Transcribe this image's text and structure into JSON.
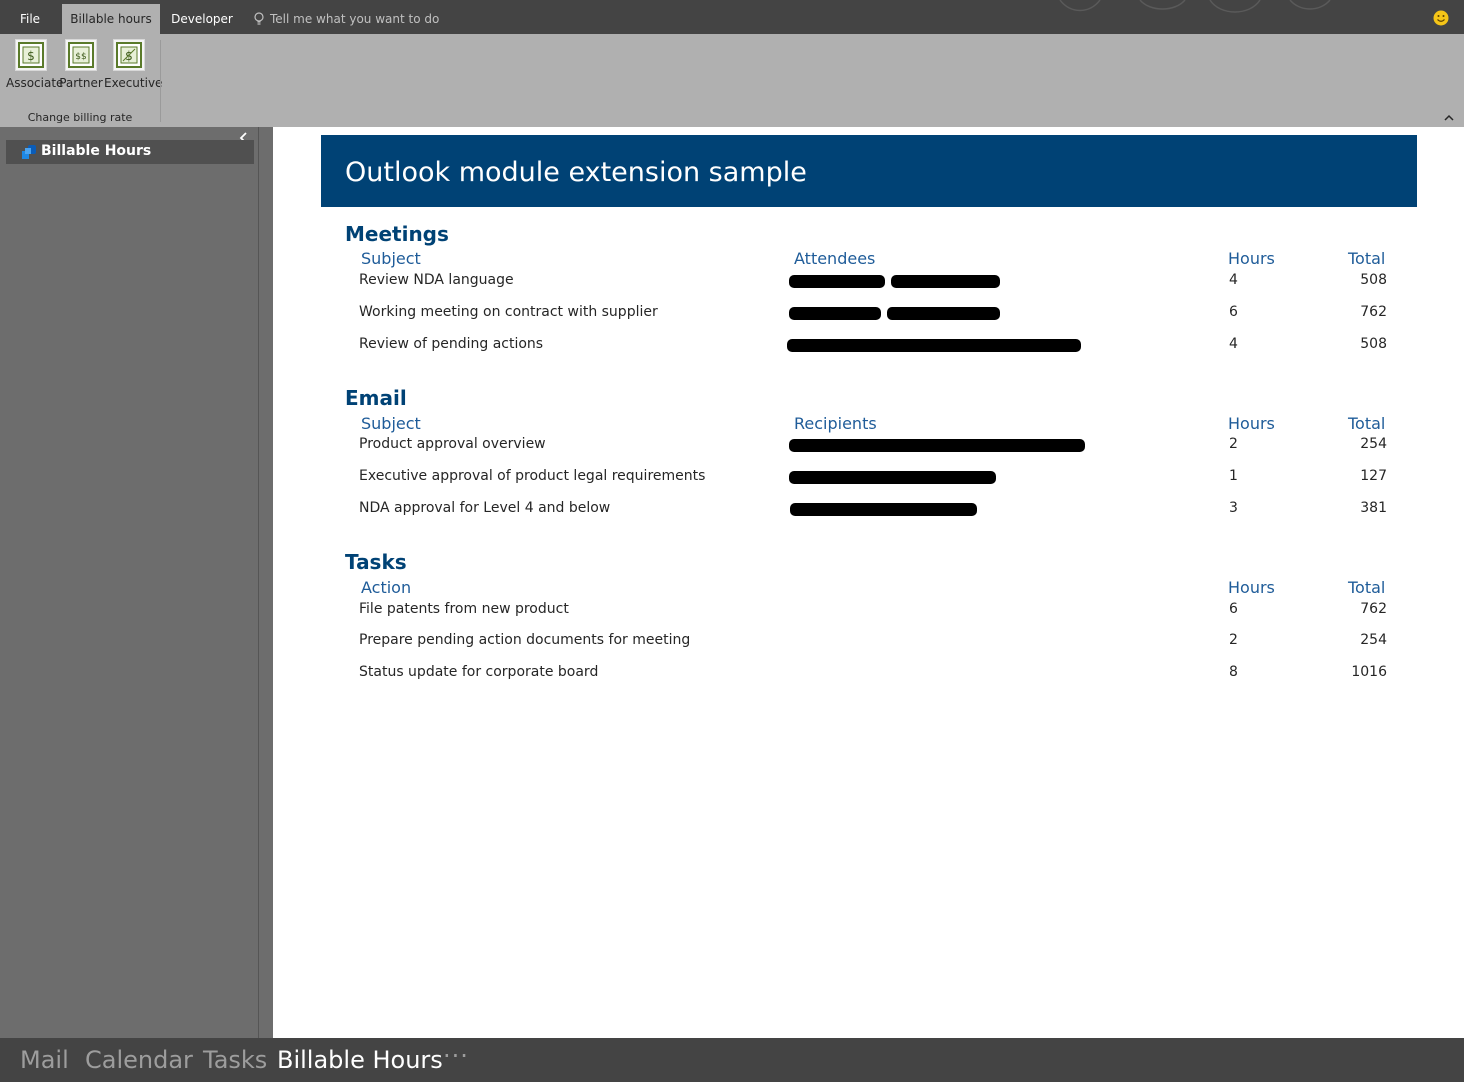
{
  "tabs": {
    "file": "File",
    "billable_hours": "Billable hours",
    "developer": "Developer",
    "tell_me_placeholder": "Tell me what you want to do"
  },
  "ribbon": {
    "buttons": [
      {
        "label": "Associate",
        "icon": "dollar-icon"
      },
      {
        "label": "Partner",
        "icon": "dollar-icon"
      },
      {
        "label": "Executive",
        "icon": "dollar-icon"
      }
    ],
    "group_label": "Change billing rate"
  },
  "navigation": {
    "item": "Billable Hours"
  },
  "main": {
    "title": "Outlook module extension sample",
    "meetings": {
      "title": "Meetings",
      "headers": {
        "subject": "Subject",
        "attendees": "Attendees",
        "hours": "Hours",
        "total": "Total"
      },
      "rows": [
        {
          "subject": "Review NDA language",
          "hours": "4",
          "total": "508"
        },
        {
          "subject": "Working meeting on contract with supplier",
          "hours": "6",
          "total": "762"
        },
        {
          "subject": "Review of pending actions",
          "hours": "4",
          "total": "508"
        }
      ]
    },
    "email": {
      "title": "Email",
      "headers": {
        "subject": "Subject",
        "recipients": "Recipients",
        "hours": "Hours",
        "total": "Total"
      },
      "rows": [
        {
          "subject": "Product approval overview",
          "hours": "2",
          "total": "254"
        },
        {
          "subject": "Executive approval of product legal requirements",
          "hours": "1",
          "total": "127"
        },
        {
          "subject": "NDA approval for Level 4 and below",
          "hours": "3",
          "total": "381"
        }
      ]
    },
    "tasks": {
      "title": "Tasks",
      "headers": {
        "action": "Action",
        "hours": "Hours",
        "total": "Total"
      },
      "rows": [
        {
          "action": "File patents from new product",
          "hours": "6",
          "total": "762"
        },
        {
          "action": "Prepare pending action documents for meeting",
          "hours": "2",
          "total": "254"
        },
        {
          "action": "Status update for corporate board",
          "hours": "8",
          "total": "1016"
        }
      ]
    }
  },
  "modules": {
    "mail": "Mail",
    "calendar": "Calendar",
    "tasks": "Tasks",
    "billable_hours": "Billable Hours",
    "more": "···"
  },
  "colors": {
    "banner": "#004275",
    "section_title": "#004275",
    "column_header": "#1f5c99",
    "title_bar": "#444444",
    "ribbon": "#b0b0b0",
    "nav_pane": "#6d6d6d"
  }
}
